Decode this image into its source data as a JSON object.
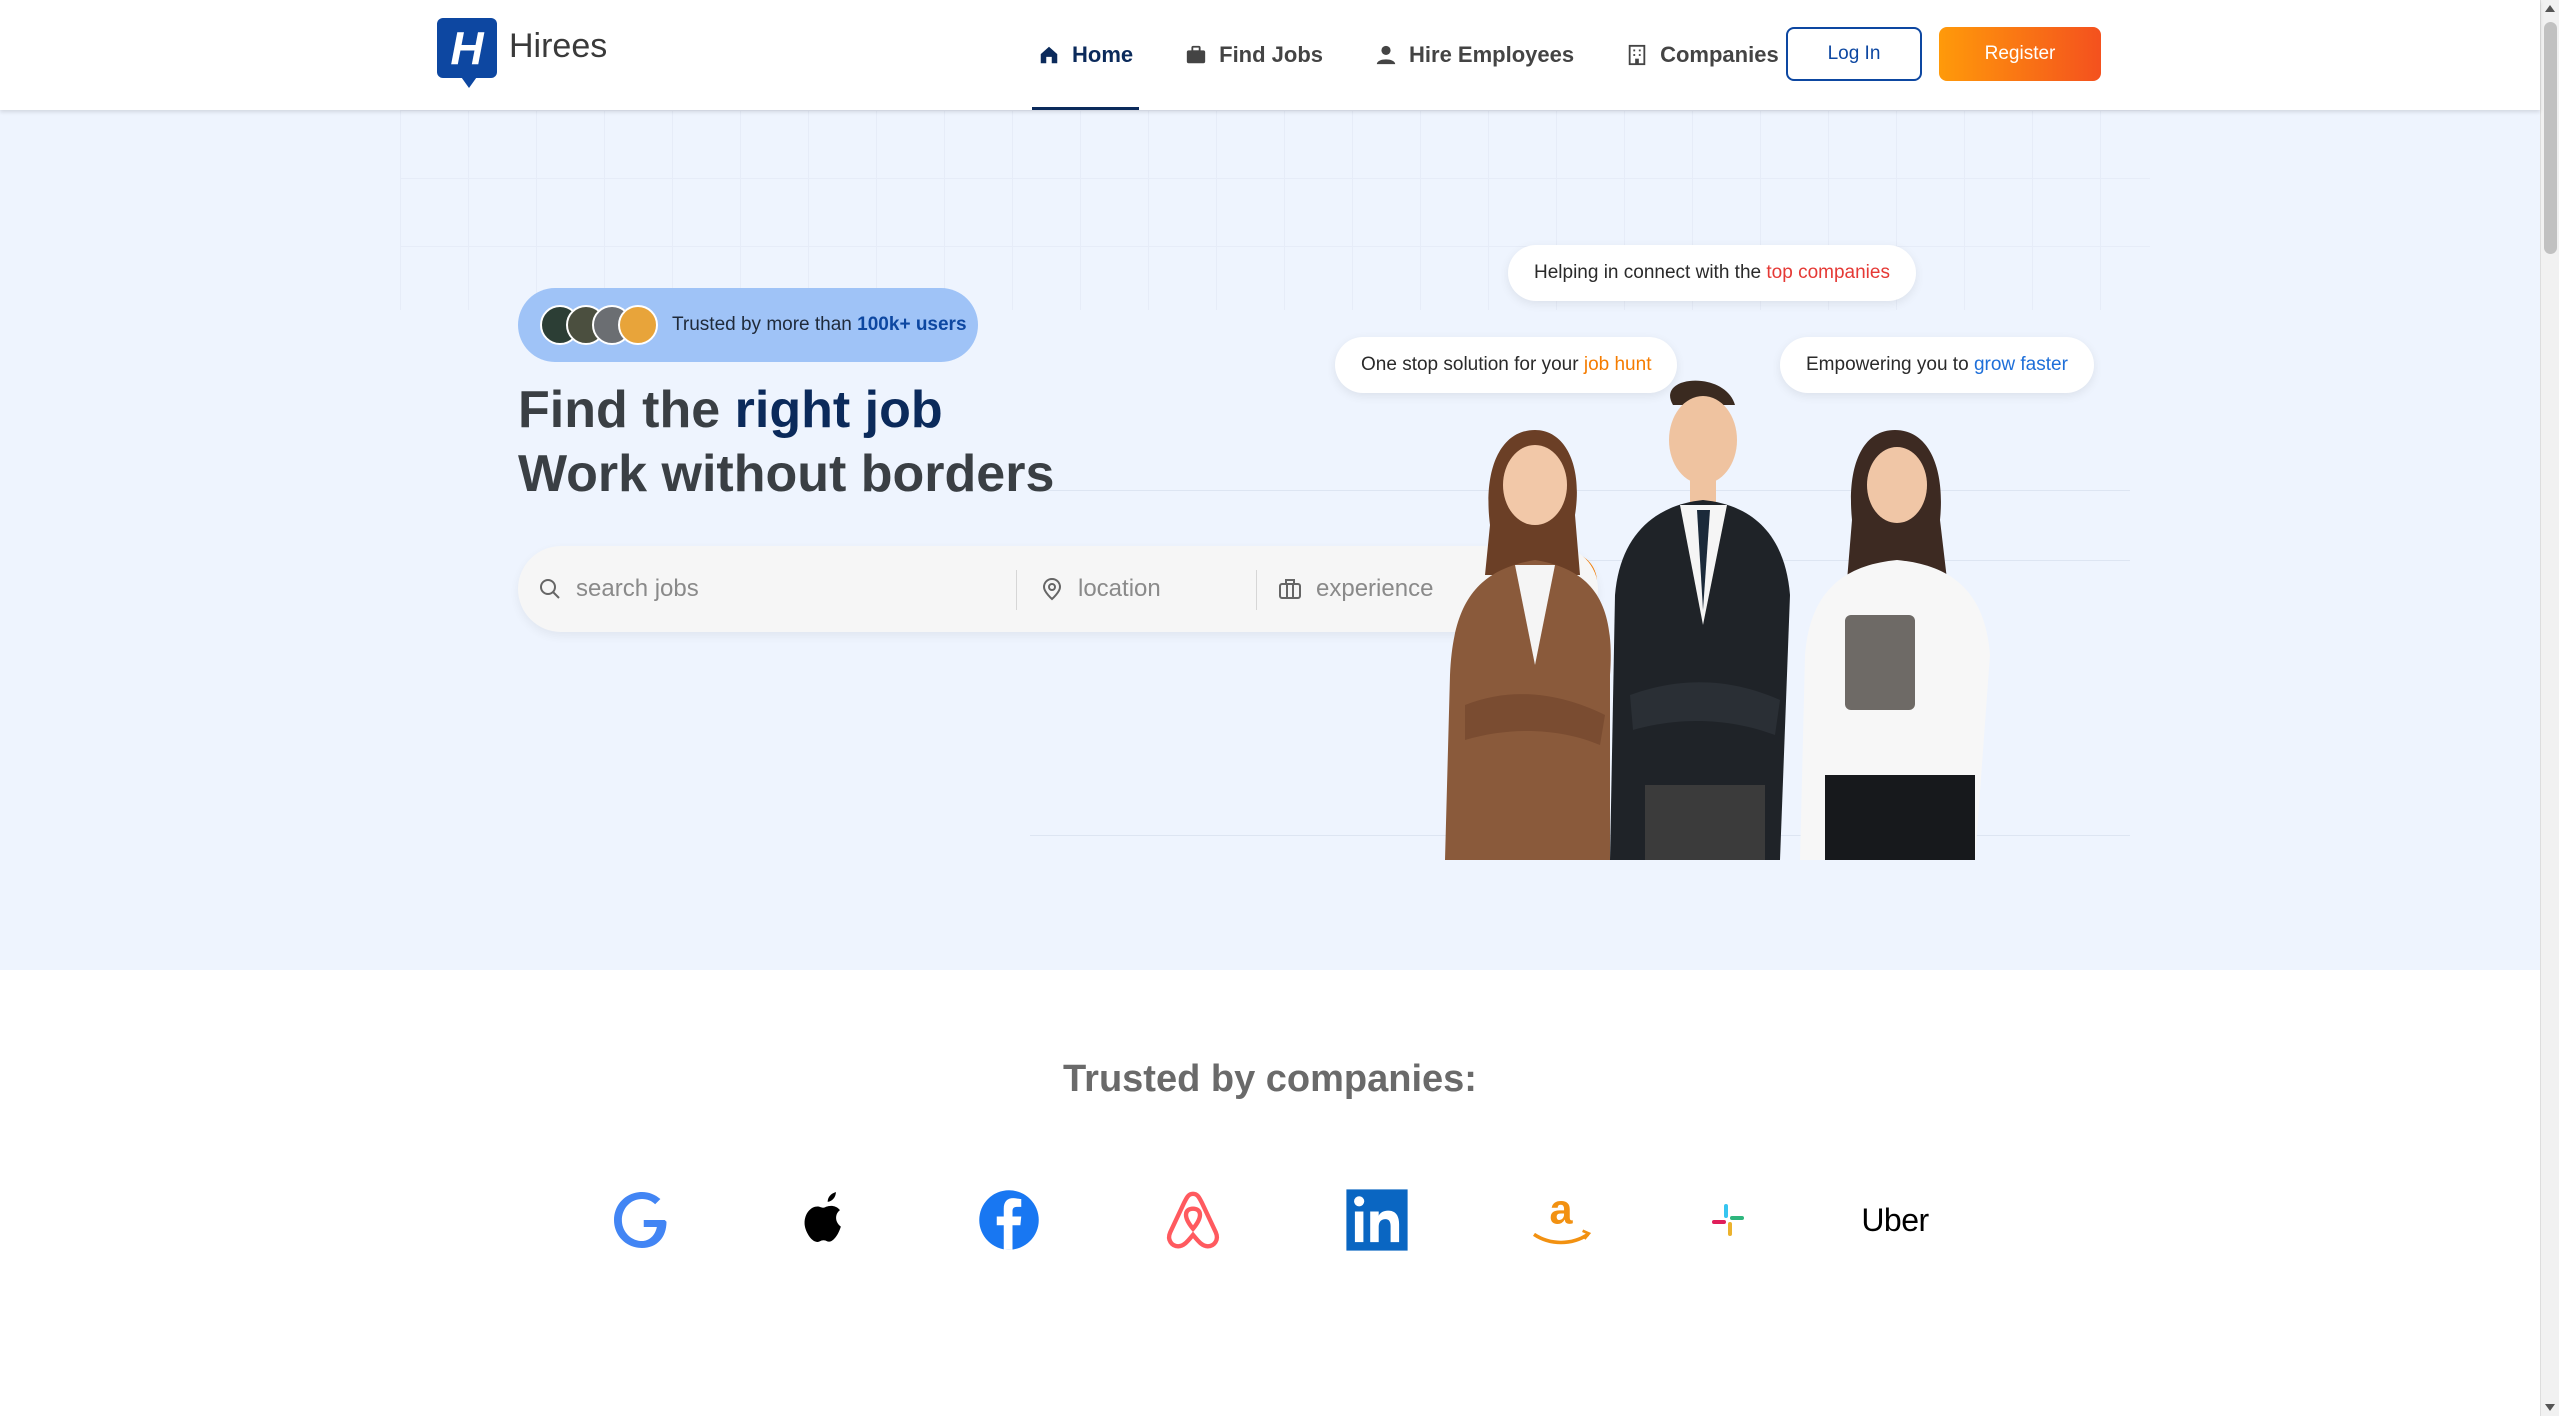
{
  "brand": {
    "name": "Hirees",
    "logo_letter": "H"
  },
  "nav": {
    "items": [
      {
        "label": "Home",
        "icon": "home-icon",
        "active": true
      },
      {
        "label": "Find Jobs",
        "icon": "briefcase-icon",
        "active": false
      },
      {
        "label": "Hire Employees",
        "icon": "person-icon",
        "active": false
      },
      {
        "label": "Companies",
        "icon": "building-icon",
        "active": false
      }
    ],
    "login_label": "Log In",
    "register_label": "Register"
  },
  "hero": {
    "trust_prefix": "Trusted by more than ",
    "trust_highlight": "100k+ users",
    "headline_line1_prefix": "Find the ",
    "headline_line1_highlight": "right job",
    "headline_line2": "Work without borders",
    "search": {
      "jobs_placeholder": "search jobs",
      "location_placeholder": "location",
      "experience_placeholder": "experience"
    },
    "bubbles": [
      {
        "prefix": "Helping in connect with the ",
        "highlight": "top companies",
        "color": "#e53935"
      },
      {
        "prefix": "One stop solution for your ",
        "highlight": "job hunt",
        "color": "#f57c00"
      },
      {
        "prefix": "Empowering you to ",
        "highlight": "grow faster",
        "color": "#1e6fd9"
      }
    ]
  },
  "trusted": {
    "title": "Trusted by companies:",
    "companies": [
      "google-logo",
      "apple-logo",
      "facebook-logo",
      "airbnb-logo",
      "linkedin-logo",
      "amazon-logo",
      "slack-logo",
      "Uber"
    ]
  },
  "colors": {
    "primary": "#0d47a1",
    "navy": "#0b2a5b",
    "accent_orange": "#f57c00",
    "hero_bg": "#eef4fe"
  }
}
